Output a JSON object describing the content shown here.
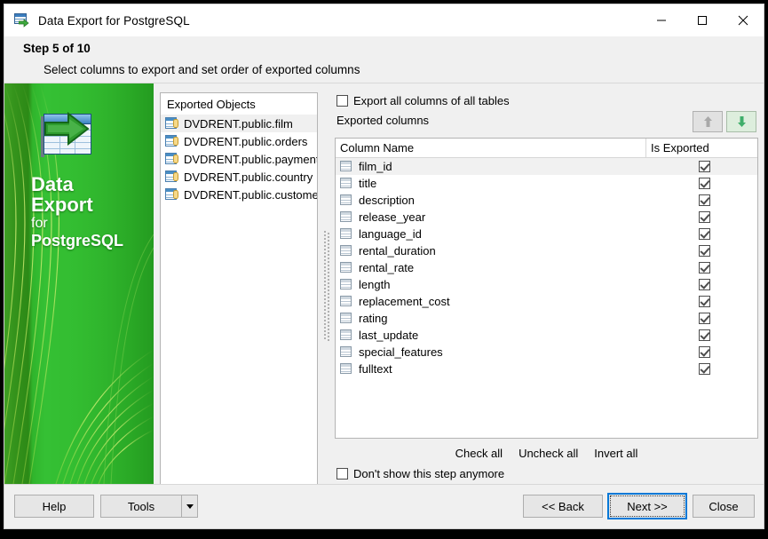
{
  "window": {
    "title": "Data Export for PostgreSQL",
    "icon": "data-export-icon",
    "controls": {
      "minimize": "minimize-icon",
      "maximize": "maximize-icon",
      "close": "close-icon"
    }
  },
  "header": {
    "step": "Step 5 of 10",
    "subtitle": "Select columns to export and set order of exported columns"
  },
  "banner": {
    "line1": "Data",
    "line2": "Export",
    "line3": "for",
    "line4": "PostgreSQL",
    "logo_icon": "table-export-icon",
    "green_light": "#35c034",
    "green_dark": "#2c8a16"
  },
  "objects_panel": {
    "header": "Exported Objects",
    "items": [
      {
        "label": "DVDRENT.public.film",
        "selected": true
      },
      {
        "label": "DVDRENT.public.orders",
        "selected": false
      },
      {
        "label": "DVDRENT.public.payment",
        "selected": false
      },
      {
        "label": "DVDRENT.public.country",
        "selected": false
      },
      {
        "label": "DVDRENT.public.customer",
        "selected": false
      }
    ]
  },
  "options": {
    "export_all_label": "Export all columns of all tables",
    "export_all_checked": false,
    "exported_columns_label": "Exported columns",
    "move_up_label": "move-up",
    "move_down_label": "move-down",
    "move_up_enabled": false,
    "move_down_enabled": true
  },
  "grid": {
    "columns": [
      "Column Name",
      "Is Exported"
    ],
    "rows": [
      {
        "name": "film_id",
        "exported": true,
        "selected": true
      },
      {
        "name": "title",
        "exported": true,
        "selected": false
      },
      {
        "name": "description",
        "exported": true,
        "selected": false
      },
      {
        "name": "release_year",
        "exported": true,
        "selected": false
      },
      {
        "name": "language_id",
        "exported": true,
        "selected": false
      },
      {
        "name": "rental_duration",
        "exported": true,
        "selected": false
      },
      {
        "name": "rental_rate",
        "exported": true,
        "selected": false
      },
      {
        "name": "length",
        "exported": true,
        "selected": false
      },
      {
        "name": "replacement_cost",
        "exported": true,
        "selected": false
      },
      {
        "name": "rating",
        "exported": true,
        "selected": false
      },
      {
        "name": "last_update",
        "exported": true,
        "selected": false
      },
      {
        "name": "special_features",
        "exported": true,
        "selected": false
      },
      {
        "name": "fulltext",
        "exported": true,
        "selected": false
      }
    ]
  },
  "actions": {
    "check_all": "Check all",
    "uncheck_all": "Uncheck all",
    "invert_all": "Invert all",
    "dont_show_label": "Don't show this step anymore",
    "dont_show_checked": false
  },
  "footer": {
    "help": "Help",
    "tools": "Tools",
    "tools_dropdown_icon": "chevron-down-icon",
    "back": "<< Back",
    "next": "Next >>",
    "close": "Close"
  }
}
